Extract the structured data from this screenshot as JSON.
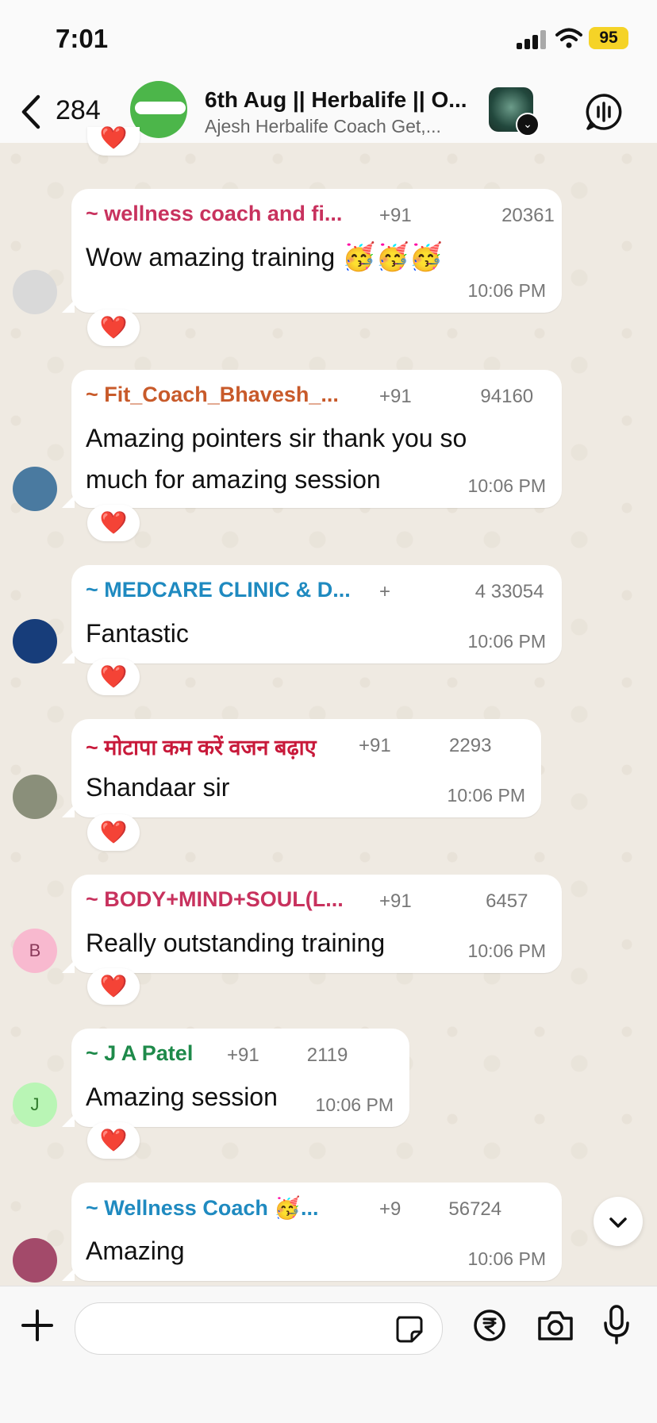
{
  "status": {
    "time": "7:01",
    "battery": "95"
  },
  "header": {
    "back_count": "284",
    "title": "6th Aug || Herbalife || O...",
    "subtitle": "Ajesh Herbalife Coach Get,..."
  },
  "messages": [
    {
      "sender": "~ wellness coach and fi...",
      "sender_color": "#c8325e",
      "phone": "+91                 20361",
      "text": "Wow amazing training",
      "time": "10:06 PM",
      "reaction": "❤️"
    },
    {
      "sender": "~ Fit_Coach_Bhavesh_...",
      "sender_color": "#c85a2a",
      "phone": "+91             94160",
      "text": "Amazing pointers sir thank you so much for amazing session",
      "time": "10:06 PM",
      "reaction": "❤️"
    },
    {
      "sender": "~ MEDCARE CLINIC & D...",
      "sender_color": "#1f8ac0",
      "phone": "+                4 33054",
      "text": "Fantastic",
      "time": "10:06 PM",
      "reaction": "❤️"
    },
    {
      "sender": "~ मोटापा कम करें वजन बढ़ाए",
      "sender_color": "#c8193a",
      "phone": "+91           2293",
      "text": "Shandaar sir",
      "time": "10:06 PM",
      "reaction": "❤️"
    },
    {
      "sender": "~ BODY+MIND+SOUL(L...",
      "sender_color": "#c8325e",
      "phone": "+91              6457",
      "text": "Really outstanding training",
      "time": "10:06 PM",
      "reaction": "❤️",
      "avatar_letter": "B"
    },
    {
      "sender": "~ J A Patel",
      "sender_color": "#1e8a4a",
      "phone": "+91         2119",
      "text": "Amazing session",
      "time": "10:06 PM",
      "reaction": "❤️",
      "avatar_letter": "J"
    },
    {
      "sender": "~ Wellness Coach 🥳...",
      "sender_color": "#1f8ac0",
      "phone": "+9         56724",
      "text": "Amazing",
      "time": "10:06 PM"
    }
  ],
  "composer": {
    "placeholder": ""
  }
}
